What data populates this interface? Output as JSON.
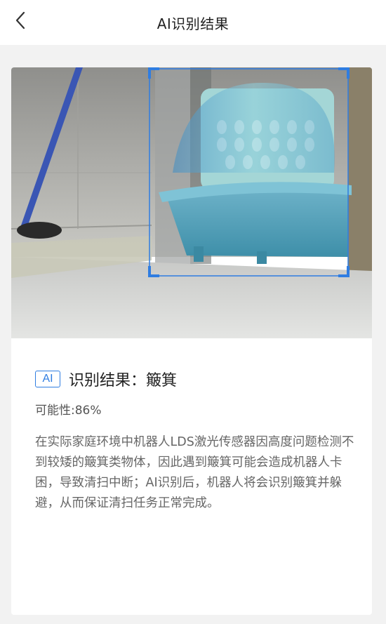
{
  "header": {
    "title": "AI识别结果",
    "back_icon": "chevron-left-icon"
  },
  "photo": {
    "detected_object": "簸箕",
    "box_color": "#2f7de1"
  },
  "result": {
    "badge": "AI",
    "text": "识别结果：簸箕",
    "probability": "可能性:86%",
    "description": "在实际家庭环境中机器人LDS激光传感器因高度问题检测不到较矮的簸箕类物体，因此遇到簸箕可能会造成机器人卡困，导致清扫中断；AI识别后，机器人将会识别簸箕并躲避，从而保证清扫任务正常完成。"
  },
  "colors": {
    "accent": "#2f7de1",
    "page_bg": "#f2f2f2",
    "card_bg": "#ffffff"
  }
}
